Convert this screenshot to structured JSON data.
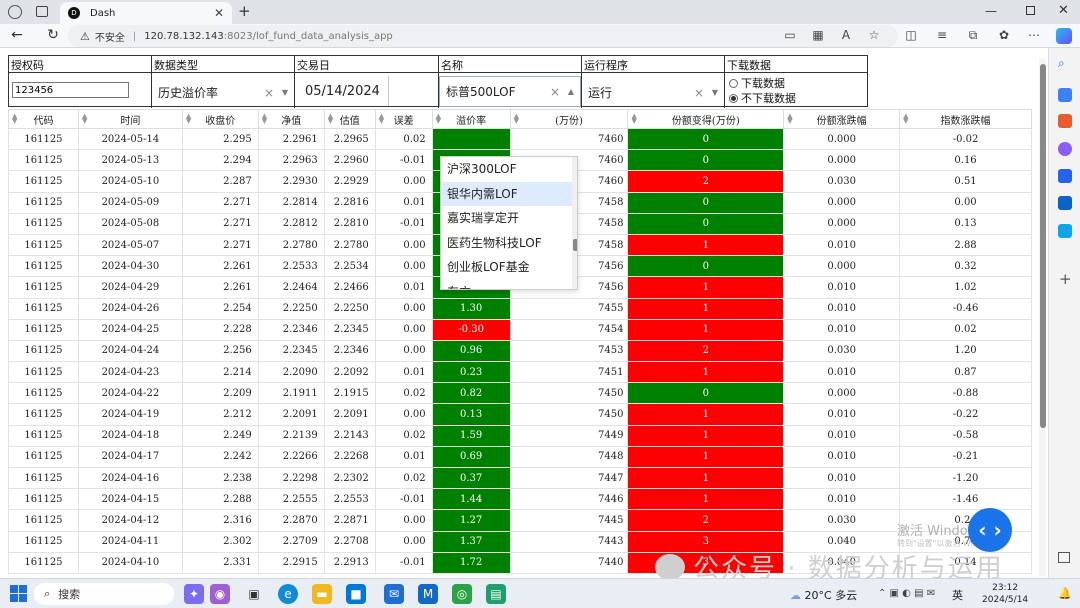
{
  "browser": {
    "tab_title": "Dash",
    "security_label": "不安全",
    "url_host": "120.78.132.143",
    "url_path": ":8023/lof_fund_data_analysis_app"
  },
  "controls": {
    "auth_header": "授权码",
    "auth_value": "123456",
    "datatype_header": "数据类型",
    "datatype_value": "历史溢价率",
    "date_header": "交易日",
    "date_value": "05/14/2024",
    "name_header": "名称",
    "name_value": "标普500LOF",
    "run_header": "运行程序",
    "run_value": "运行",
    "download_header": "下载数据",
    "download_options": [
      "下载数据",
      "不下载数据"
    ],
    "download_selected": "不下载数据",
    "clear_symbol": "×"
  },
  "dropdown_options": [
    "沪深300LOF",
    "银华内需LOF",
    "嘉实瑞享定开",
    "医药生物科技LOF",
    "创业板LOF基金",
    "东方..."
  ],
  "dropdown_highlight": "银华内需LOF",
  "table": {
    "headers": [
      "代码",
      "时间",
      "收盘价",
      "净值",
      "估值",
      "误差",
      "溢价率",
      "(万份)",
      "份额变得(万份)",
      "份额涨跌幅",
      "指数涨跌幅"
    ],
    "rows": [
      [
        "161125",
        "2024-05-14",
        "2.295",
        "2.2961",
        "2.2965",
        "0.02",
        "",
        "7460",
        "0",
        "0.000",
        "-0.02"
      ],
      [
        "161125",
        "2024-05-13",
        "2.294",
        "2.2963",
        "2.2960",
        "-0.01",
        "",
        "7460",
        "0",
        "0.000",
        "0.16"
      ],
      [
        "161125",
        "2024-05-10",
        "2.287",
        "2.2930",
        "2.2929",
        "0.00",
        "",
        "7460",
        "2",
        "0.030",
        "0.51"
      ],
      [
        "161125",
        "2024-05-09",
        "2.271",
        "2.2814",
        "2.2816",
        "0.01",
        "",
        "7458",
        "0",
        "0.000",
        "0.00"
      ],
      [
        "161125",
        "2024-05-08",
        "2.271",
        "2.2812",
        "2.2810",
        "-0.01",
        "",
        "7458",
        "0",
        "0.000",
        "0.13"
      ],
      [
        "161125",
        "2024-05-07",
        "2.271",
        "2.2780",
        "2.2780",
        "0.00",
        "0.31",
        "7458",
        "1",
        "0.010",
        "2.88"
      ],
      [
        "161125",
        "2024-04-30",
        "2.261",
        "2.2533",
        "2.2534",
        "0.00",
        "0.34",
        "7456",
        "0",
        "0.000",
        "0.32"
      ],
      [
        "161125",
        "2024-04-29",
        "2.261",
        "2.2464",
        "2.2466",
        "0.01",
        "0.65",
        "7456",
        "1",
        "0.010",
        "1.02"
      ],
      [
        "161125",
        "2024-04-26",
        "2.254",
        "2.2250",
        "2.2250",
        "0.00",
        "1.30",
        "7455",
        "1",
        "0.010",
        "-0.46"
      ],
      [
        "161125",
        "2024-04-25",
        "2.228",
        "2.2346",
        "2.2345",
        "0.00",
        "-0.30",
        "7454",
        "1",
        "0.010",
        "0.02"
      ],
      [
        "161125",
        "2024-04-24",
        "2.256",
        "2.2345",
        "2.2346",
        "0.00",
        "0.96",
        "7453",
        "2",
        "0.030",
        "1.20"
      ],
      [
        "161125",
        "2024-04-23",
        "2.214",
        "2.2090",
        "2.2092",
        "0.01",
        "0.23",
        "7451",
        "1",
        "0.010",
        "0.87"
      ],
      [
        "161125",
        "2024-04-22",
        "2.209",
        "2.1911",
        "2.1915",
        "0.02",
        "0.82",
        "7450",
        "0",
        "0.000",
        "-0.88"
      ],
      [
        "161125",
        "2024-04-19",
        "2.212",
        "2.2091",
        "2.2091",
        "0.00",
        "0.13",
        "7450",
        "1",
        "0.010",
        "-0.22"
      ],
      [
        "161125",
        "2024-04-18",
        "2.249",
        "2.2139",
        "2.2143",
        "0.02",
        "1.59",
        "7449",
        "1",
        "0.010",
        "-0.58"
      ],
      [
        "161125",
        "2024-04-17",
        "2.242",
        "2.2266",
        "2.2268",
        "0.01",
        "0.69",
        "7448",
        "1",
        "0.010",
        "-0.21"
      ],
      [
        "161125",
        "2024-04-16",
        "2.238",
        "2.2298",
        "2.2302",
        "0.02",
        "0.37",
        "7447",
        "1",
        "0.010",
        "-1.20"
      ],
      [
        "161125",
        "2024-04-15",
        "2.288",
        "2.2555",
        "2.2553",
        "-0.01",
        "1.44",
        "7446",
        "1",
        "0.010",
        "-1.46"
      ],
      [
        "161125",
        "2024-04-12",
        "2.316",
        "2.2870",
        "2.2871",
        "0.00",
        "1.27",
        "7445",
        "2",
        "0.030",
        "0.24"
      ],
      [
        "161125",
        "2024-04-11",
        "2.302",
        "2.2709",
        "2.2708",
        "0.00",
        "1.37",
        "7443",
        "3",
        "0.040",
        "0.74"
      ],
      [
        "161125",
        "2024-04-10",
        "2.331",
        "2.2915",
        "2.2913",
        "-0.01",
        "1.72",
        "7440",
        "3",
        "0.040",
        "0.14"
      ]
    ]
  },
  "overlays": {
    "activate_title": "激活 Windows",
    "activate_sub": "转到\"设置\"以激活 Windows。",
    "watermark": "公众号 · 数据分析与运用",
    "fab_label": "‹ ›"
  },
  "taskbar": {
    "search_label": "搜索",
    "weather": "20°C 多云",
    "lang": "英",
    "time": "23:12",
    "date": "2024/5/14"
  },
  "colors": {
    "up": "#ff0000",
    "down": "#008000"
  }
}
